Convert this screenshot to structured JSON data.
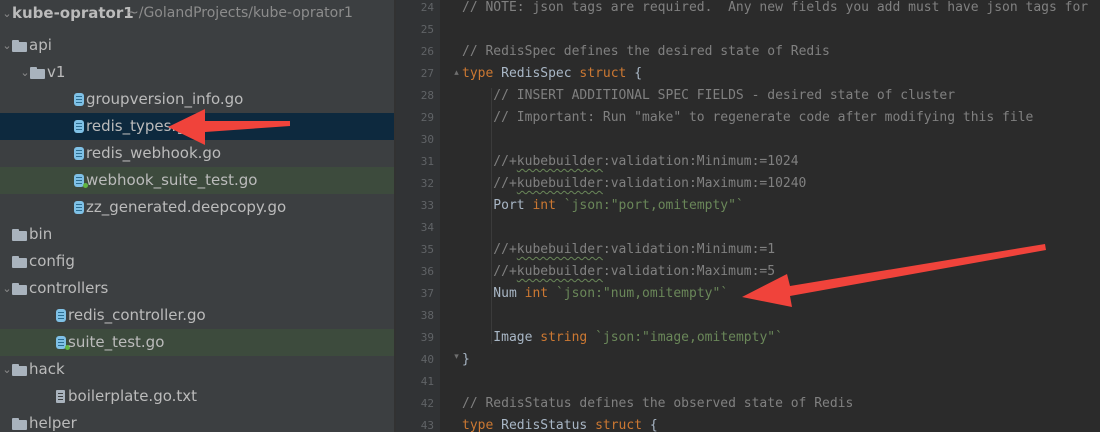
{
  "project": {
    "name": "kube-oprator1",
    "path": "~/GolandProjects/kube-oprator1"
  },
  "tree": [
    {
      "label": "api",
      "type": "folder",
      "depth": 0,
      "expanded": true,
      "state": ""
    },
    {
      "label": "v1",
      "type": "folder",
      "depth": 1,
      "expanded": true,
      "state": ""
    },
    {
      "label": "groupversion_info.go",
      "type": "go",
      "depth": 2,
      "state": ""
    },
    {
      "label": "redis_types.go",
      "type": "go",
      "depth": 2,
      "state": "selected"
    },
    {
      "label": "redis_webhook.go",
      "type": "go",
      "depth": 2,
      "state": ""
    },
    {
      "label": "webhook_suite_test.go",
      "type": "go-test",
      "depth": 2,
      "state": "highlight"
    },
    {
      "label": "zz_generated.deepcopy.go",
      "type": "go",
      "depth": 2,
      "state": ""
    },
    {
      "label": "bin",
      "type": "folder",
      "depth": 0,
      "expanded": false,
      "state": ""
    },
    {
      "label": "config",
      "type": "folder",
      "depth": 0,
      "expanded": false,
      "state": ""
    },
    {
      "label": "controllers",
      "type": "folder",
      "depth": 0,
      "expanded": true,
      "state": ""
    },
    {
      "label": "redis_controller.go",
      "type": "go",
      "depth": 1,
      "state": ""
    },
    {
      "label": "suite_test.go",
      "type": "go-test",
      "depth": 1,
      "state": "highlight"
    },
    {
      "label": "hack",
      "type": "folder",
      "depth": 0,
      "expanded": true,
      "state": ""
    },
    {
      "label": "boilerplate.go.txt",
      "type": "txt",
      "depth": 1,
      "state": ""
    },
    {
      "label": "helper",
      "type": "folder",
      "depth": 0,
      "expanded": false,
      "state": ""
    }
  ],
  "code": [
    {
      "n": "24",
      "tokens": [
        {
          "c": "cm",
          "t": "// NOTE: json tags are required.  Any new fields you add must have json tags for"
        }
      ]
    },
    {
      "n": "25",
      "tokens": []
    },
    {
      "n": "26",
      "tokens": [
        {
          "c": "cm",
          "t": "// "
        },
        {
          "c": "cm",
          "t": "RedisSpec"
        },
        {
          "c": "cm",
          "t": " defines the desired state of Redis"
        }
      ]
    },
    {
      "n": "27",
      "tokens": [
        {
          "c": "kw",
          "t": "type "
        },
        {
          "c": "ty",
          "t": "RedisSpec "
        },
        {
          "c": "kw",
          "t": "struct "
        },
        {
          "c": "pl",
          "t": "{"
        }
      ]
    },
    {
      "n": "28",
      "tokens": [
        {
          "c": "cm",
          "t": "    // INSERT ADDITIONAL SPEC FIELDS - desired state of cluster"
        }
      ]
    },
    {
      "n": "29",
      "tokens": [
        {
          "c": "cm",
          "t": "    // Important: Run \"make\" to regenerate code after modifying this file"
        }
      ]
    },
    {
      "n": "30",
      "tokens": []
    },
    {
      "n": "31",
      "tokens": [
        {
          "c": "cm",
          "t": "    //+"
        },
        {
          "c": "cmw",
          "t": "kubebuilder"
        },
        {
          "c": "cm",
          "t": ":validation:Minimum:=1024"
        }
      ]
    },
    {
      "n": "32",
      "tokens": [
        {
          "c": "cm",
          "t": "    //+"
        },
        {
          "c": "cmw",
          "t": "kubebuilder"
        },
        {
          "c": "cm",
          "t": ":validation:Maximum:=10240"
        }
      ]
    },
    {
      "n": "33",
      "tokens": [
        {
          "c": "pl",
          "t": "    Port "
        },
        {
          "c": "kw",
          "t": "int "
        },
        {
          "c": "st",
          "t": "`json:"
        },
        {
          "c": "st",
          "t": "\"port,omitempty\""
        },
        {
          "c": "st",
          "t": "`"
        }
      ]
    },
    {
      "n": "34",
      "tokens": []
    },
    {
      "n": "35",
      "tokens": [
        {
          "c": "cm",
          "t": "    //+"
        },
        {
          "c": "cmw",
          "t": "kubebuilder"
        },
        {
          "c": "cm",
          "t": ":validation:Minimum:=1"
        }
      ]
    },
    {
      "n": "36",
      "tokens": [
        {
          "c": "cm",
          "t": "    //+"
        },
        {
          "c": "cmw",
          "t": "kubebuilder"
        },
        {
          "c": "cm",
          "t": ":validation:Maximum:=5"
        }
      ]
    },
    {
      "n": "37",
      "tokens": [
        {
          "c": "pl",
          "t": "    Num "
        },
        {
          "c": "kw",
          "t": "int "
        },
        {
          "c": "st",
          "t": "`json:"
        },
        {
          "c": "st",
          "t": "\"num,omitempty\""
        },
        {
          "c": "st",
          "t": "`"
        }
      ]
    },
    {
      "n": "38",
      "tokens": []
    },
    {
      "n": "39",
      "tokens": [
        {
          "c": "pl",
          "t": "    Image "
        },
        {
          "c": "kw",
          "t": "string "
        },
        {
          "c": "st",
          "t": "`json:"
        },
        {
          "c": "st",
          "t": "\"image,omitempty\""
        },
        {
          "c": "st",
          "t": "`"
        }
      ]
    },
    {
      "n": "40",
      "tokens": [
        {
          "c": "pl",
          "t": "}"
        }
      ]
    },
    {
      "n": "41",
      "tokens": []
    },
    {
      "n": "42",
      "tokens": [
        {
          "c": "cm",
          "t": "// "
        },
        {
          "c": "cm",
          "t": "RedisStatus"
        },
        {
          "c": "cm",
          "t": " defines the observed state of Redis"
        }
      ]
    },
    {
      "n": "43",
      "tokens": [
        {
          "c": "kw",
          "t": "type "
        },
        {
          "c": "ty",
          "t": "RedisStatus "
        },
        {
          "c": "kw",
          "t": "struct "
        },
        {
          "c": "pl",
          "t": "{"
        }
      ]
    }
  ],
  "colors": {
    "arrow": "#f0433b",
    "selected_row": "#0d293e",
    "test_row": "#3d4b3d",
    "keyword": "#cc7832",
    "string": "#6a8759",
    "comment": "#808080"
  }
}
